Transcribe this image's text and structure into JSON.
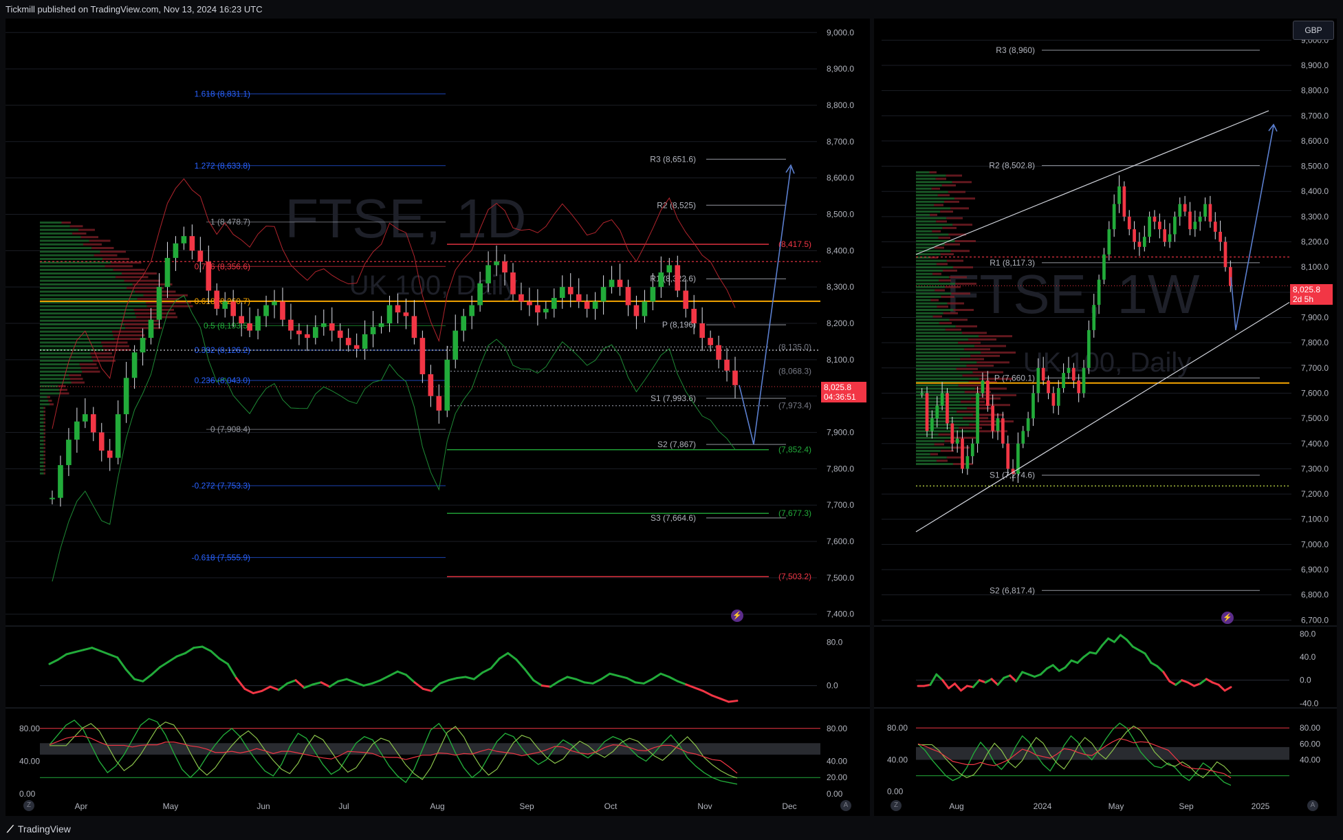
{
  "header": {
    "published": "Tickmill published on TradingView.com, Nov 13, 2024 16:23 UTC"
  },
  "footer": {
    "brand": "TradingView"
  },
  "currency_button": "GBP",
  "colors": {
    "bg": "#000000",
    "up": "#26a69a",
    "green": "#22ab3a",
    "red": "#f23645",
    "orange": "#f7a600",
    "blue": "#2962ff",
    "grid": "#1b1e26"
  },
  "chart_data": [
    {
      "type": "line",
      "name": "left-daily-main",
      "watermark": {
        "symbol": "FTSE, 1D",
        "name": "UK 100, Daily"
      },
      "y_axis": [
        9000.0,
        8900.0,
        8800.0,
        8700.0,
        8600.0,
        8500.0,
        8400.0,
        8300.0,
        8200.0,
        8100.0,
        8000.0,
        7900.0,
        7800.0,
        7700.0,
        7600.0,
        7500.0,
        7400.0
      ],
      "y_axis_labels": [
        "9,000.0",
        "8,900.0",
        "8,800.0",
        "8,700.0",
        "8,600.0",
        "8,500.0",
        "8,400.0",
        "8,300.0",
        "8,200.0",
        "8,100.0",
        "8,000.0",
        "7,900.0",
        "7,800.0",
        "7,700.0",
        "7,600.0",
        "7,500.0",
        "7,400.0"
      ],
      "ylim": [
        7390,
        9010
      ],
      "x_labels": [
        "Apr",
        "May",
        "Jun",
        "Jul",
        "Aug",
        "Sep",
        "Oct",
        "Nov",
        "Dec"
      ],
      "current_price": "8,025.8",
      "current_price_value": 8025.8,
      "countdown": "04:36:51",
      "fib_levels": [
        {
          "label": "1.618 (8,831.1)",
          "value": 8831.1,
          "color": "#2962ff"
        },
        {
          "label": "1.272 (8,633.8)",
          "value": 8633.8,
          "color": "#2962ff"
        },
        {
          "label": "1 (8,478.7)",
          "value": 8478.7,
          "color": "#9598a1"
        },
        {
          "label": "0.786 (8,356.6)",
          "value": 8356.6,
          "color": "#f23645"
        },
        {
          "label": "0.618 (8,260.7)",
          "value": 8260.7,
          "color": "#f7a600"
        },
        {
          "label": "0.5 (8,193.5)",
          "value": 8193.5,
          "color": "#22ab3a"
        },
        {
          "label": "0.382 (8,126.2)",
          "value": 8126.2,
          "color": "#2962ff"
        },
        {
          "label": "0.236 (8,043.0)",
          "value": 8043.0,
          "color": "#2962ff"
        },
        {
          "label": "0 (7,908.4)",
          "value": 7908.4,
          "color": "#9598a1"
        },
        {
          "label": "-0.272 (7,753.3)",
          "value": 7753.3,
          "color": "#2962ff"
        },
        {
          "label": "-0.618 (7,555.9)",
          "value": 7555.9,
          "color": "#2962ff"
        }
      ],
      "pivots": [
        {
          "label": "R3 (8,651.6)",
          "value": 8651.6
        },
        {
          "label": "R2 (8,525)",
          "value": 8525.0
        },
        {
          "label": "R1 (8,322.6)",
          "value": 8322.6
        },
        {
          "label": "P (8,196)",
          "value": 8196.0
        },
        {
          "label": "S1 (7,993.6)",
          "value": 7993.6
        },
        {
          "label": "S2 (7,867)",
          "value": 7867.0
        },
        {
          "label": "S3 (7,664.6)",
          "value": 7664.6
        }
      ],
      "right_levels": [
        {
          "label": "(8,417.5)",
          "value": 8417.5,
          "color": "#f23645"
        },
        {
          "label": "(8,135.0)",
          "value": 8135.0,
          "color": "#787b86"
        },
        {
          "label": "(8,068.3)",
          "value": 8068.3,
          "color": "#787b86"
        },
        {
          "label": "(7,973.4)",
          "value": 7973.4,
          "color": "#787b86"
        },
        {
          "label": "(7,852.4)",
          "value": 7852.4,
          "color": "#22ab3a"
        },
        {
          "label": "(7,677.3)",
          "value": 7677.3,
          "color": "#22ab3a"
        },
        {
          "label": "(7,503.2)",
          "value": 7503.2,
          "color": "#f23645"
        }
      ],
      "close_series": [
        7720,
        7810,
        7880,
        7930,
        7950,
        7900,
        7850,
        7830,
        7950,
        8050,
        8120,
        8160,
        8210,
        8300,
        8380,
        8420,
        8440,
        8400,
        8370,
        8290,
        8240,
        8260,
        8220,
        8200,
        8180,
        8220,
        8250,
        8260,
        8210,
        8180,
        8170,
        8160,
        8190,
        8200,
        8180,
        8160,
        8140,
        8130,
        8170,
        8190,
        8200,
        8250,
        8230,
        8220,
        8160,
        8060,
        8000,
        7960,
        8100,
        8180,
        8220,
        8250,
        8310,
        8360,
        8370,
        8340,
        8280,
        8260,
        8250,
        8230,
        8240,
        8270,
        8300,
        8280,
        8260,
        8240,
        8260,
        8300,
        8320,
        8300,
        8250,
        8220,
        8260,
        8300,
        8340,
        8360,
        8290,
        8240,
        8200,
        8160,
        8140,
        8100,
        8070,
        8030
      ]
    },
    {
      "type": "line",
      "name": "left-oscillator-1",
      "y_axis_labels": [
        "80.0",
        "0.0"
      ],
      "ylim": [
        -40,
        100
      ],
      "values": [
        40,
        48,
        58,
        62,
        66,
        70,
        64,
        58,
        52,
        30,
        12,
        8,
        20,
        34,
        44,
        54,
        60,
        70,
        72,
        64,
        50,
        40,
        14,
        -6,
        -14,
        -10,
        -2,
        -8,
        4,
        10,
        -4,
        2,
        6,
        -2,
        8,
        12,
        6,
        0,
        4,
        10,
        18,
        26,
        20,
        6,
        -6,
        -10,
        4,
        10,
        14,
        16,
        12,
        24,
        32,
        50,
        60,
        48,
        30,
        10,
        0,
        -2,
        8,
        16,
        12,
        6,
        4,
        12,
        22,
        18,
        14,
        6,
        4,
        12,
        22,
        16,
        8,
        2,
        -4,
        -10,
        -18,
        -24,
        -30,
        -28
      ]
    },
    {
      "type": "line",
      "name": "left-oscillator-2",
      "y_axis_labels": [
        "80.00",
        "40.00",
        "20.00",
        "0.00"
      ],
      "left_labels": [
        "80.00",
        "40.00",
        "0.00"
      ],
      "ylim": [
        -5,
        100
      ],
      "values": [
        60,
        72,
        84,
        90,
        80,
        60,
        40,
        26,
        34,
        48,
        66,
        84,
        92,
        88,
        72,
        50,
        30,
        20,
        30,
        46,
        60,
        72,
        80,
        70,
        54,
        40,
        28,
        22,
        36,
        58,
        74,
        68,
        52,
        36,
        24,
        30,
        46,
        62,
        70,
        66,
        50,
        34,
        22,
        14,
        30,
        54,
        78,
        86,
        72,
        50,
        32,
        20,
        28,
        46,
        64,
        74,
        70,
        56,
        44,
        36,
        42,
        56,
        66,
        60,
        50,
        44,
        52,
        64,
        70,
        66,
        56,
        46,
        40,
        50,
        62,
        72,
        60,
        44,
        34,
        26,
        20,
        16,
        14,
        12
      ]
    },
    {
      "type": "line",
      "name": "right-weekly-main",
      "watermark": {
        "symbol": "FTSE, 1W",
        "name": "UK 100, Daily"
      },
      "y_axis": [
        9000.0,
        8900.0,
        8800.0,
        8700.0,
        8600.0,
        8500.0,
        8400.0,
        8300.0,
        8200.0,
        8100.0,
        8000.0,
        7900.0,
        7800.0,
        7700.0,
        7600.0,
        7500.0,
        7400.0,
        7300.0,
        7200.0,
        7100.0,
        7000.0,
        6900.0,
        6800.0,
        6700.0
      ],
      "y_axis_labels": [
        "9,000.0",
        "8,900.0",
        "8,800.0",
        "8,700.0",
        "8,600.0",
        "8,500.0",
        "8,400.0",
        "8,300.0",
        "8,200.0",
        "8,100.0",
        "8,000.0",
        "7,900.0",
        "7,800.0",
        "7,700.0",
        "7,600.0",
        "7,500.0",
        "7,400.0",
        "7,300.0",
        "7,200.0",
        "7,100.0",
        "7,000.0",
        "6,900.0",
        "6,800.0",
        "6,700.0"
      ],
      "ylim": [
        6690,
        9050
      ],
      "x_labels": [
        "Aug",
        "2024",
        "May",
        "Sep",
        "2025"
      ],
      "current_price": "8,025.8",
      "current_price_value": 8025.8,
      "countdown": "2d 5h",
      "pivots": [
        {
          "label": "R3 (8,960)",
          "value": 8960.0
        },
        {
          "label": "R2 (8,502.8)",
          "value": 8502.8
        },
        {
          "label": "R1 (8,117.3)",
          "value": 8117.3
        },
        {
          "label": "P (7,660.1)",
          "value": 7660.1
        },
        {
          "label": "S1 (7,274.6)",
          "value": 7274.6
        },
        {
          "label": "S2 (6,817.4)",
          "value": 6817.4
        }
      ],
      "close_series": [
        7600,
        7450,
        7500,
        7550,
        7600,
        7480,
        7400,
        7420,
        7300,
        7350,
        7400,
        7600,
        7650,
        7550,
        7450,
        7500,
        7400,
        7300,
        7280,
        7400,
        7450,
        7500,
        7600,
        7700,
        7650,
        7600,
        7550,
        7620,
        7680,
        7700,
        7650,
        7600,
        7700,
        7850,
        7950,
        8050,
        8150,
        8250,
        8350,
        8420,
        8300,
        8250,
        8200,
        8180,
        8220,
        8300,
        8280,
        8250,
        8200,
        8230,
        8300,
        8350,
        8320,
        8250,
        8280,
        8300,
        8350,
        8280,
        8240,
        8200,
        8100,
        8025
      ]
    },
    {
      "type": "line",
      "name": "right-oscillator-1",
      "y_axis_labels": [
        "80.0",
        "40.0",
        "0.0",
        "-40.0"
      ],
      "ylim": [
        -42,
        84
      ],
      "values": [
        -10,
        -10,
        -8,
        10,
        0,
        -14,
        -6,
        -18,
        -10,
        -12,
        0,
        -4,
        2,
        -8,
        4,
        8,
        -2,
        14,
        10,
        6,
        10,
        20,
        26,
        16,
        22,
        34,
        30,
        40,
        48,
        46,
        60,
        72,
        66,
        78,
        70,
        58,
        52,
        46,
        30,
        24,
        14,
        -2,
        -8,
        0,
        -4,
        -10,
        -6,
        2,
        -4,
        -8,
        -18,
        -12
      ]
    },
    {
      "type": "line",
      "name": "right-oscillator-2",
      "y_axis_labels": [
        "80.00",
        "60.00",
        "40.00"
      ],
      "left_labels": [
        "80.00",
        "40.00",
        "0.00"
      ],
      "ylim": [
        -8,
        100
      ],
      "values": [
        60,
        52,
        40,
        30,
        20,
        14,
        18,
        30,
        48,
        62,
        52,
        36,
        28,
        38,
        56,
        70,
        62,
        46,
        34,
        26,
        40,
        58,
        70,
        62,
        48,
        40,
        52,
        66,
        78,
        86,
        80,
        66,
        50,
        40,
        32,
        30,
        36,
        30,
        20,
        14,
        24,
        36,
        30,
        20,
        12,
        8
      ]
    }
  ]
}
